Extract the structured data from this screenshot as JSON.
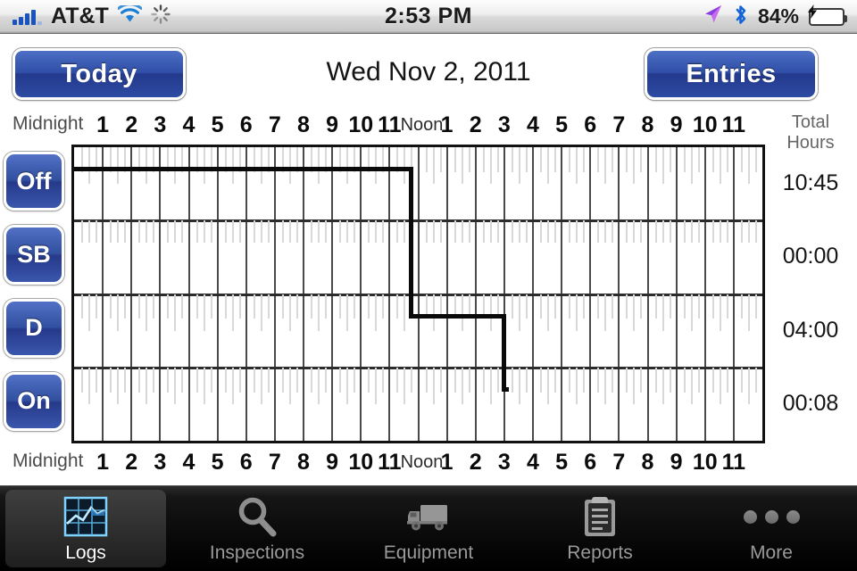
{
  "statusbar": {
    "carrier": "AT&T",
    "time": "2:53 PM",
    "battery_pct": "84%",
    "icons": [
      "signal-bars-icon",
      "wifi-icon",
      "activity-spinner-icon",
      "location-arrow-icon",
      "bluetooth-icon",
      "battery-charging-icon"
    ]
  },
  "header": {
    "today_label": "Today",
    "entries_label": "Entries",
    "date_title": "Wed Nov 2, 2011"
  },
  "ruler": {
    "midnight_label": "Midnight",
    "noon_label": "Noon",
    "hours": [
      "1",
      "2",
      "3",
      "4",
      "5",
      "6",
      "7",
      "8",
      "9",
      "10",
      "11"
    ],
    "total_header_line1": "Total",
    "total_header_line2": "Hours"
  },
  "duty_rows": [
    {
      "code": "Off",
      "total": "10:45"
    },
    {
      "code": "SB",
      "total": "00:00"
    },
    {
      "code": "D",
      "total": "04:00"
    },
    {
      "code": "On",
      "total": "00:08"
    }
  ],
  "tabs": [
    {
      "label": "Logs",
      "icon": "logs-chart-icon",
      "active": true
    },
    {
      "label": "Inspections",
      "icon": "magnifier-icon",
      "active": false
    },
    {
      "label": "Equipment",
      "icon": "truck-icon",
      "active": false
    },
    {
      "label": "Reports",
      "icon": "clipboard-icon",
      "active": false
    },
    {
      "label": "More",
      "icon": "ellipsis-icon",
      "active": false
    }
  ],
  "colors": {
    "accent_blue": "#2f4ea8",
    "grid_line": "#2c2c2c",
    "tick": "#d8d8d8",
    "duty_line": "#0a0a0a",
    "tab_active_text": "#ffffff",
    "tab_text": "#9a9a9a"
  },
  "chart_data": {
    "type": "line",
    "title": "Wed Nov 2, 2011",
    "xlabel": "",
    "ylabel": "",
    "xlim": [
      0,
      24
    ],
    "categories": [
      "Off",
      "SB",
      "D",
      "On"
    ],
    "grid": true,
    "x_tick_labels": [
      "Midnight",
      "1",
      "2",
      "3",
      "4",
      "5",
      "6",
      "7",
      "8",
      "9",
      "10",
      "11",
      "Noon",
      "1",
      "2",
      "3",
      "4",
      "5",
      "6",
      "7",
      "8",
      "9",
      "10",
      "11"
    ],
    "totals": [
      "10:45",
      "00:00",
      "04:00",
      "00:08"
    ],
    "segments": [
      {
        "status": "Off",
        "start_hour": 0.0,
        "end_hour": 11.75,
        "duration": "11:45"
      },
      {
        "status": "D",
        "start_hour": 11.75,
        "end_hour": 15.0,
        "duration": "03:15"
      },
      {
        "status": "On",
        "start_hour": 15.0,
        "end_hour": 15.15,
        "duration": "00:08"
      }
    ]
  }
}
